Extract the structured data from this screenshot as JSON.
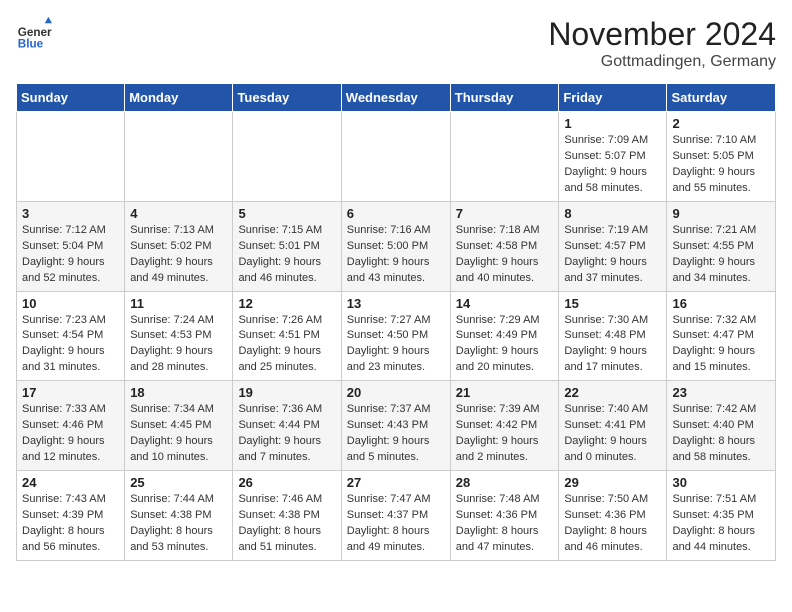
{
  "logo": {
    "general": "General",
    "blue": "Blue"
  },
  "title": {
    "month": "November 2024",
    "location": "Gottmadingen, Germany"
  },
  "headers": [
    "Sunday",
    "Monday",
    "Tuesday",
    "Wednesday",
    "Thursday",
    "Friday",
    "Saturday"
  ],
  "weeks": [
    [
      {
        "day": "",
        "info": ""
      },
      {
        "day": "",
        "info": ""
      },
      {
        "day": "",
        "info": ""
      },
      {
        "day": "",
        "info": ""
      },
      {
        "day": "",
        "info": ""
      },
      {
        "day": "1",
        "info": "Sunrise: 7:09 AM\nSunset: 5:07 PM\nDaylight: 9 hours and 58 minutes."
      },
      {
        "day": "2",
        "info": "Sunrise: 7:10 AM\nSunset: 5:05 PM\nDaylight: 9 hours and 55 minutes."
      }
    ],
    [
      {
        "day": "3",
        "info": "Sunrise: 7:12 AM\nSunset: 5:04 PM\nDaylight: 9 hours and 52 minutes."
      },
      {
        "day": "4",
        "info": "Sunrise: 7:13 AM\nSunset: 5:02 PM\nDaylight: 9 hours and 49 minutes."
      },
      {
        "day": "5",
        "info": "Sunrise: 7:15 AM\nSunset: 5:01 PM\nDaylight: 9 hours and 46 minutes."
      },
      {
        "day": "6",
        "info": "Sunrise: 7:16 AM\nSunset: 5:00 PM\nDaylight: 9 hours and 43 minutes."
      },
      {
        "day": "7",
        "info": "Sunrise: 7:18 AM\nSunset: 4:58 PM\nDaylight: 9 hours and 40 minutes."
      },
      {
        "day": "8",
        "info": "Sunrise: 7:19 AM\nSunset: 4:57 PM\nDaylight: 9 hours and 37 minutes."
      },
      {
        "day": "9",
        "info": "Sunrise: 7:21 AM\nSunset: 4:55 PM\nDaylight: 9 hours and 34 minutes."
      }
    ],
    [
      {
        "day": "10",
        "info": "Sunrise: 7:23 AM\nSunset: 4:54 PM\nDaylight: 9 hours and 31 minutes."
      },
      {
        "day": "11",
        "info": "Sunrise: 7:24 AM\nSunset: 4:53 PM\nDaylight: 9 hours and 28 minutes."
      },
      {
        "day": "12",
        "info": "Sunrise: 7:26 AM\nSunset: 4:51 PM\nDaylight: 9 hours and 25 minutes."
      },
      {
        "day": "13",
        "info": "Sunrise: 7:27 AM\nSunset: 4:50 PM\nDaylight: 9 hours and 23 minutes."
      },
      {
        "day": "14",
        "info": "Sunrise: 7:29 AM\nSunset: 4:49 PM\nDaylight: 9 hours and 20 minutes."
      },
      {
        "day": "15",
        "info": "Sunrise: 7:30 AM\nSunset: 4:48 PM\nDaylight: 9 hours and 17 minutes."
      },
      {
        "day": "16",
        "info": "Sunrise: 7:32 AM\nSunset: 4:47 PM\nDaylight: 9 hours and 15 minutes."
      }
    ],
    [
      {
        "day": "17",
        "info": "Sunrise: 7:33 AM\nSunset: 4:46 PM\nDaylight: 9 hours and 12 minutes."
      },
      {
        "day": "18",
        "info": "Sunrise: 7:34 AM\nSunset: 4:45 PM\nDaylight: 9 hours and 10 minutes."
      },
      {
        "day": "19",
        "info": "Sunrise: 7:36 AM\nSunset: 4:44 PM\nDaylight: 9 hours and 7 minutes."
      },
      {
        "day": "20",
        "info": "Sunrise: 7:37 AM\nSunset: 4:43 PM\nDaylight: 9 hours and 5 minutes."
      },
      {
        "day": "21",
        "info": "Sunrise: 7:39 AM\nSunset: 4:42 PM\nDaylight: 9 hours and 2 minutes."
      },
      {
        "day": "22",
        "info": "Sunrise: 7:40 AM\nSunset: 4:41 PM\nDaylight: 9 hours and 0 minutes."
      },
      {
        "day": "23",
        "info": "Sunrise: 7:42 AM\nSunset: 4:40 PM\nDaylight: 8 hours and 58 minutes."
      }
    ],
    [
      {
        "day": "24",
        "info": "Sunrise: 7:43 AM\nSunset: 4:39 PM\nDaylight: 8 hours and 56 minutes."
      },
      {
        "day": "25",
        "info": "Sunrise: 7:44 AM\nSunset: 4:38 PM\nDaylight: 8 hours and 53 minutes."
      },
      {
        "day": "26",
        "info": "Sunrise: 7:46 AM\nSunset: 4:38 PM\nDaylight: 8 hours and 51 minutes."
      },
      {
        "day": "27",
        "info": "Sunrise: 7:47 AM\nSunset: 4:37 PM\nDaylight: 8 hours and 49 minutes."
      },
      {
        "day": "28",
        "info": "Sunrise: 7:48 AM\nSunset: 4:36 PM\nDaylight: 8 hours and 47 minutes."
      },
      {
        "day": "29",
        "info": "Sunrise: 7:50 AM\nSunset: 4:36 PM\nDaylight: 8 hours and 46 minutes."
      },
      {
        "day": "30",
        "info": "Sunrise: 7:51 AM\nSunset: 4:35 PM\nDaylight: 8 hours and 44 minutes."
      }
    ]
  ]
}
